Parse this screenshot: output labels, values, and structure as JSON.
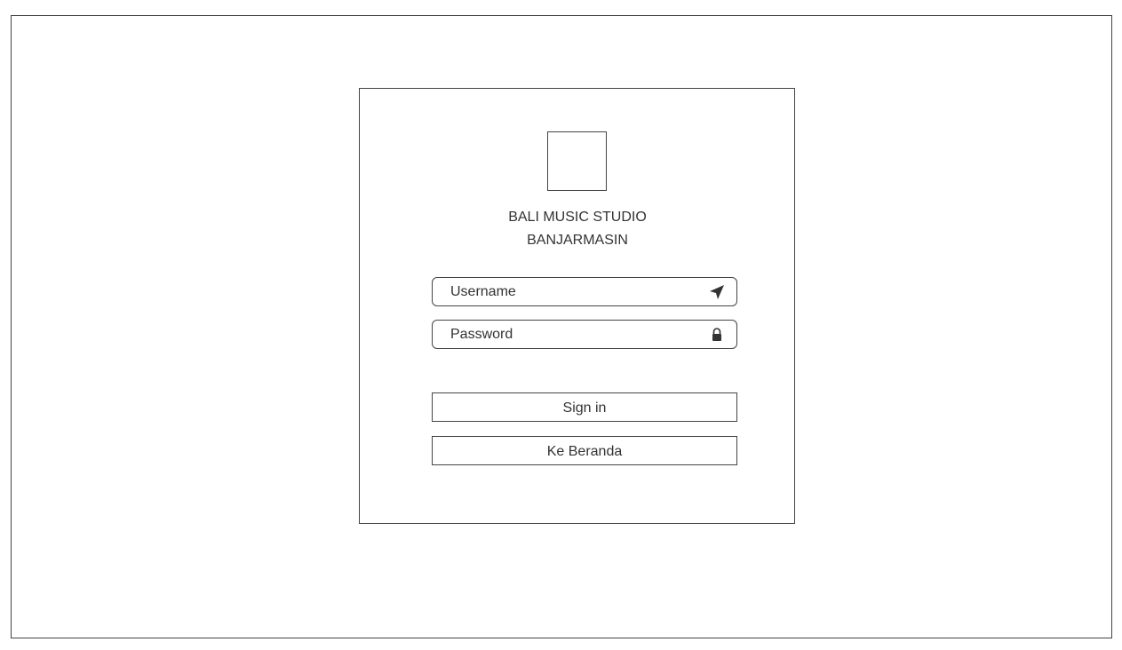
{
  "brand": {
    "line1": "BALI MUSIC STUDIO",
    "line2": "BANJARMASIN"
  },
  "form": {
    "username": {
      "placeholder": "Username",
      "value": "",
      "icon": "paper-plane-icon"
    },
    "password": {
      "placeholder": "Password",
      "value": "",
      "icon": "lock-icon"
    },
    "signin_label": "Sign in",
    "home_label": "Ke Beranda"
  },
  "colors": {
    "border": "#444444",
    "text": "#333333",
    "background": "#ffffff"
  }
}
